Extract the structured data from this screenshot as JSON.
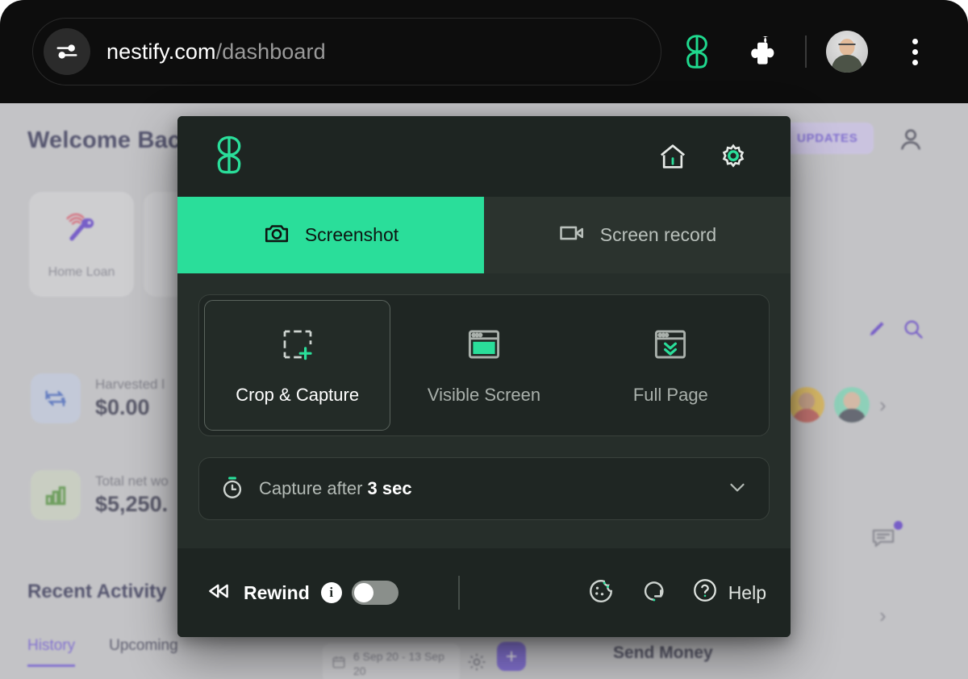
{
  "browser": {
    "url_host": "nestify.com",
    "url_path": "/dashboard",
    "icons": {
      "omnibox_left": "tune-sliders-icon",
      "brand": "bb-logo-icon",
      "extensions": "puzzle-piece-icon",
      "profile": "avatar-icon",
      "menu": "three-dot-menu-icon"
    }
  },
  "dashboard": {
    "welcome_title": "Welcome Back",
    "updates_badge": "UPDATES",
    "home_loan_label": "Home Loan",
    "stats": [
      {
        "label": "Harvested l",
        "value": "$0.00",
        "icon": "swap-dollars-icon"
      },
      {
        "label": "Total net wo",
        "value": "$5,250.",
        "icon": "bar-chart-icon"
      }
    ],
    "recent_activity_title": "Recent Activity",
    "tabs": [
      {
        "label": "History",
        "active": true
      },
      {
        "label": "Upcoming",
        "active": false
      }
    ],
    "date_range": "6 Sep 20 - 13 Sep 20",
    "add_button_label": "+",
    "send_money_label": "Send Money"
  },
  "popup": {
    "brand_icon": "bb-logo-icon",
    "header_icons": [
      {
        "name": "home-icon"
      },
      {
        "name": "gear-icon"
      }
    ],
    "tabs": [
      {
        "label": "Screenshot",
        "icon": "camera-icon",
        "active": true
      },
      {
        "label": "Screen record",
        "icon": "video-camera-icon",
        "active": false
      }
    ],
    "modes": [
      {
        "label": "Crop & Capture",
        "icon": "crop-select-icon",
        "selected": true
      },
      {
        "label": "Visible Screen",
        "icon": "browser-window-icon",
        "selected": false
      },
      {
        "label": "Full Page",
        "icon": "full-page-scroll-icon",
        "selected": false
      }
    ],
    "timer": {
      "prefix": "Capture after",
      "value": "3 sec",
      "icon": "stopwatch-icon",
      "chevron": "chevron-down-icon"
    },
    "footer": {
      "rewind_label": "Rewind",
      "info_glyph": "i",
      "rewind_enabled": false,
      "icons": [
        {
          "name": "cookie-icon"
        },
        {
          "name": "refresh-loop-icon"
        }
      ],
      "help_label": "Help",
      "help_icon": "question-circle-icon"
    }
  },
  "colors": {
    "accent_green": "#2ade9a",
    "popup_bg": "#262e2a",
    "popup_panel": "#1e2522",
    "brand_purple": "#5b3fd6",
    "chrome_bg": "#0d0d0d"
  }
}
